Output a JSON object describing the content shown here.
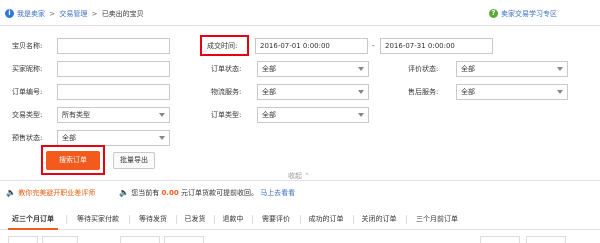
{
  "breadcrumb": {
    "icon": "info-icon",
    "items": [
      "我是卖家",
      "交易管理",
      "已卖出的宝贝"
    ],
    "separator": ">"
  },
  "help": {
    "icon": "help-icon",
    "label": "卖家交易学习专区"
  },
  "filters": {
    "item_name": {
      "label": "宝贝名称:",
      "value": ""
    },
    "deal_time": {
      "label": "成交时间:",
      "start": "2016-07-01 0:00:00",
      "dash": "-",
      "end": "2016-07-31 0:00:00"
    },
    "buyer_nick": {
      "label": "买家昵称:",
      "value": ""
    },
    "order_status": {
      "label": "订单状态:",
      "value": "全部"
    },
    "review_status": {
      "label": "评价状态:",
      "value": "全部"
    },
    "order_no": {
      "label": "订单编号:",
      "value": ""
    },
    "logistics": {
      "label": "物流服务:",
      "value": "全部"
    },
    "after_sale": {
      "label": "售后服务:",
      "value": "全部"
    },
    "trade_type": {
      "label": "交易类型:",
      "value": "所有类型"
    },
    "order_type": {
      "label": "订单类型:",
      "value": "全部"
    },
    "presale_status": {
      "label": "预售状态:",
      "value": "全部"
    }
  },
  "actions": {
    "search": "搜索订单",
    "export": "批量导出",
    "collapse": "收起"
  },
  "notices": {
    "tip1": "教你完美避开职业差评师",
    "tip2_prefix": "您当前有",
    "tip2_amount": "0.00",
    "tip2_suffix": "元订单货款可提前收回。",
    "tip2_link": "马上去看看"
  },
  "tabs": [
    "近三个月订单",
    "等待买家付款",
    "等待发货",
    "已发货",
    "退款中",
    "需要评价",
    "成功的订单",
    "关闭的订单",
    "三个月前订单"
  ],
  "colors": {
    "accent": "#f25a1e",
    "highlight": "#e60012",
    "link": "#3a6ec4"
  }
}
